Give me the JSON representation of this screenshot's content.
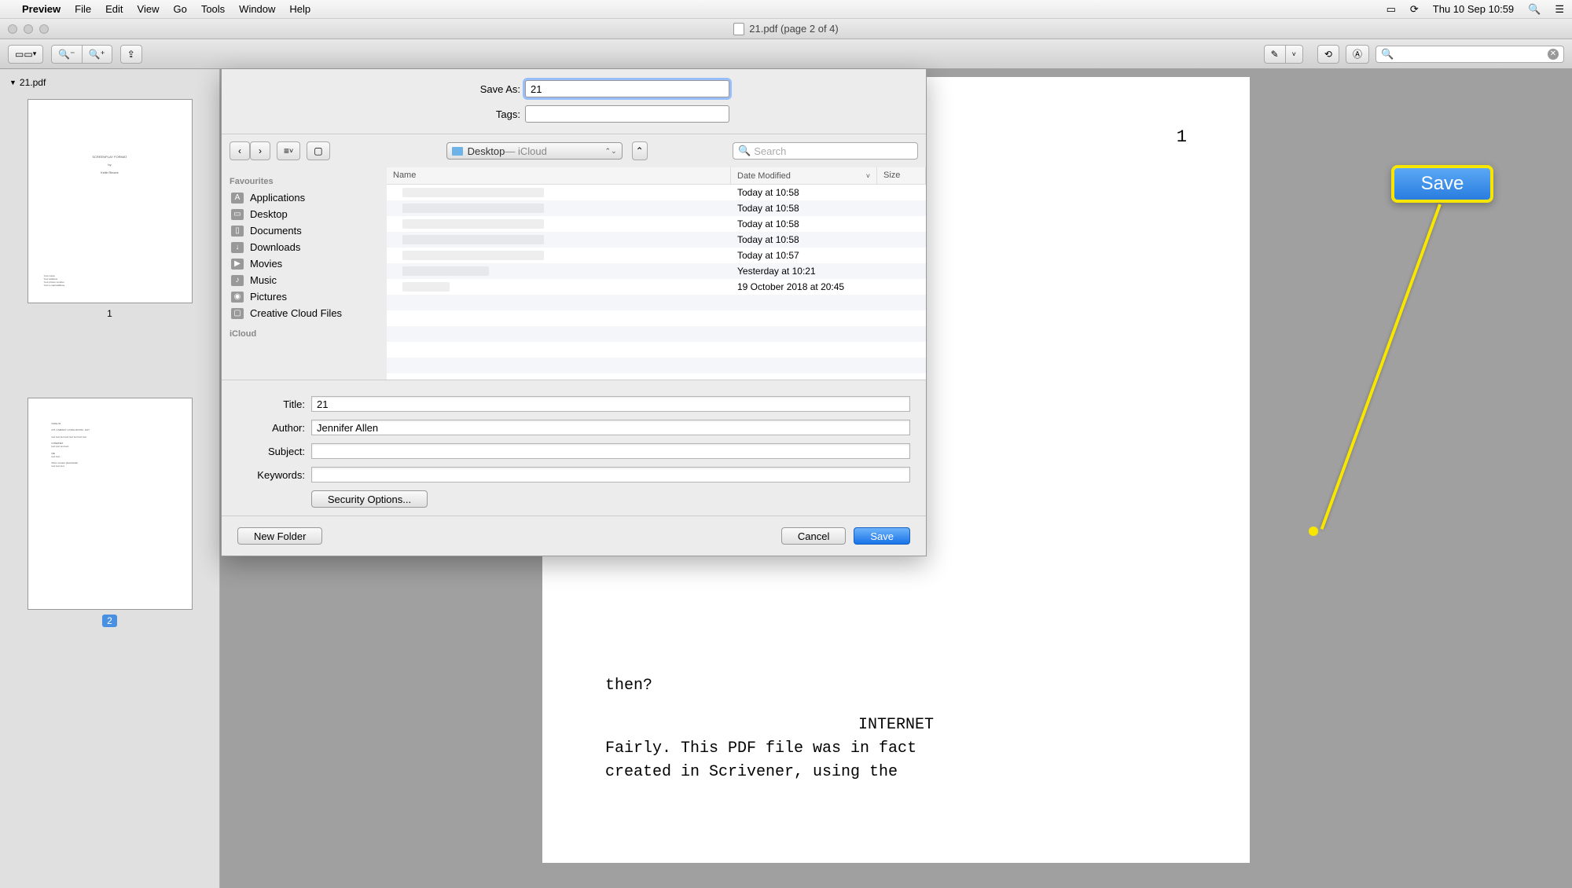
{
  "menubar": {
    "app": "Preview",
    "items": [
      "File",
      "Edit",
      "View",
      "Go",
      "Tools",
      "Window",
      "Help"
    ],
    "clock": "Thu 10 Sep  10:59"
  },
  "window": {
    "title": "21.pdf (page 2 of 4)"
  },
  "sidebar_doc": {
    "filename": "21.pdf",
    "page1_label": "1",
    "page2_label": "2"
  },
  "document_body": {
    "page_num": "1",
    "line1": "then?",
    "line2": "INTERNET",
    "line3": "Fairly. This PDF file was in fact",
    "line4": "created in Scrivener, using the"
  },
  "dialog": {
    "save_as_label": "Save As:",
    "save_as_value": "21",
    "tags_label": "Tags:",
    "tags_value": "",
    "location_name": "Desktop",
    "location_sub": " — iCloud",
    "search_placeholder": "Search",
    "favourites_header": "Favourites",
    "favourites": [
      {
        "label": "Applications"
      },
      {
        "label": "Desktop"
      },
      {
        "label": "Documents"
      },
      {
        "label": "Downloads"
      },
      {
        "label": "Movies"
      },
      {
        "label": "Music"
      },
      {
        "label": "Pictures"
      },
      {
        "label": "Creative Cloud Files"
      }
    ],
    "icloud_header": "iCloud",
    "columns": {
      "name": "Name",
      "date": "Date Modified",
      "size": "Size"
    },
    "rows": [
      {
        "date": "Today at 10:58"
      },
      {
        "date": "Today at 10:58"
      },
      {
        "date": "Today at 10:58"
      },
      {
        "date": "Today at 10:58"
      },
      {
        "date": "Today at 10:57"
      },
      {
        "date": "Yesterday at 10:21"
      },
      {
        "date": "19 October 2018 at 20:45"
      }
    ],
    "metadata": {
      "title_label": "Title:",
      "title_value": "21",
      "author_label": "Author:",
      "author_value": "Jennifer Allen",
      "subject_label": "Subject:",
      "subject_value": "",
      "keywords_label": "Keywords:",
      "keywords_value": ""
    },
    "security_btn": "Security Options...",
    "new_folder_btn": "New Folder",
    "cancel_btn": "Cancel",
    "save_btn": "Save"
  },
  "callout": {
    "label": "Save"
  }
}
